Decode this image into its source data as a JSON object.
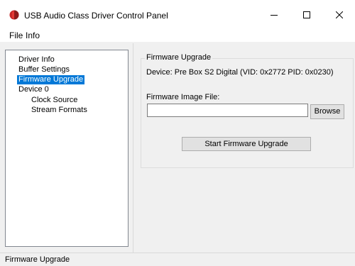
{
  "window": {
    "title": "USB Audio Class Driver Control Panel",
    "icon": "red-app-icon",
    "controls": {
      "minimize": "minimize-icon",
      "maximize": "maximize-icon",
      "close": "close-icon"
    }
  },
  "menu": {
    "items": [
      {
        "label": "File"
      },
      {
        "label": "Info"
      }
    ]
  },
  "tree": {
    "items": [
      {
        "label": "Driver Info",
        "level": 0,
        "selected": false
      },
      {
        "label": "Buffer Settings",
        "level": 0,
        "selected": false
      },
      {
        "label": "Firmware Upgrade",
        "level": 0,
        "selected": true
      },
      {
        "label": "Device 0",
        "level": 0,
        "selected": false
      },
      {
        "label": "Clock Source",
        "level": 1,
        "selected": false
      },
      {
        "label": "Stream Formats",
        "level": 1,
        "selected": false
      }
    ]
  },
  "firmware": {
    "group_title": "Firmware Upgrade",
    "device_info": "Device: Pre Box S2 Digital (VID: 0x2772 PID: 0x0230)",
    "image_file_label": "Firmware Image File:",
    "image_file_value": "",
    "browse_label": "Browse",
    "start_label": "Start Firmware Upgrade"
  },
  "status": {
    "text": "Firmware Upgrade"
  },
  "colors": {
    "selection": "#0078d7",
    "app_icon": "#d0312d"
  }
}
